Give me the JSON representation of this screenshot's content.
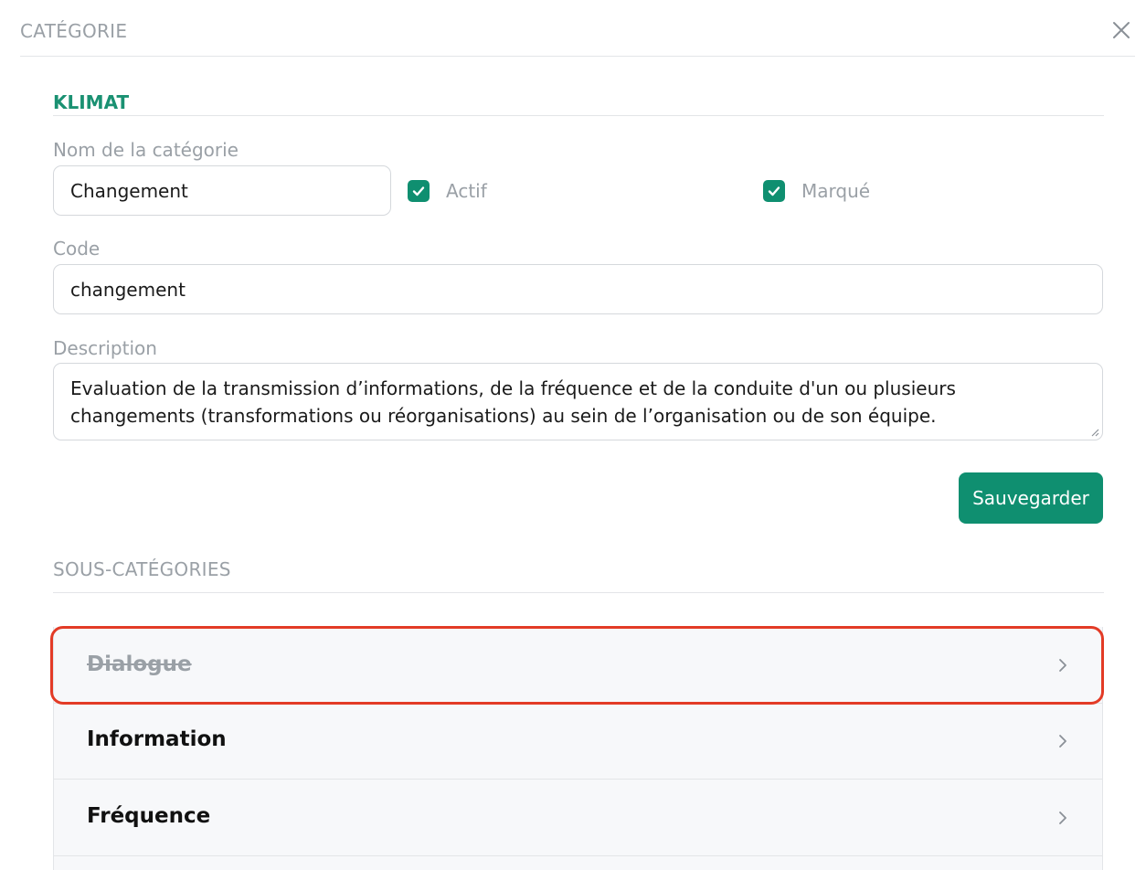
{
  "header": {
    "title": "CATÉGORIE",
    "close_icon": "close-icon"
  },
  "category": {
    "section_title": "KLIMAT"
  },
  "form": {
    "name_label": "Nom de la catégorie",
    "name_value": "Changement",
    "active_label": "Actif",
    "active_checked": true,
    "marked_label": "Marqué",
    "marked_checked": true,
    "code_label": "Code",
    "code_value": "changement",
    "description_label": "Description",
    "description_value": "Evaluation de la transmission d’informations, de la fréquence et de la conduite d'un ou plusieurs changements (transformations ou réorganisations) au sein de l’organisation ou de son équipe.",
    "save_label": "Sauvegarder"
  },
  "subcategories": {
    "title": "SOUS-CATÉGORIES",
    "items": [
      {
        "label": "Dialogue",
        "inactive": true,
        "highlighted": true
      },
      {
        "label": "Information",
        "inactive": false
      },
      {
        "label": "Fréquence",
        "inactive": false
      }
    ]
  },
  "colors": {
    "accent": "#0f8f70",
    "highlight": "#e33b26",
    "muted": "#9aa0a6"
  }
}
